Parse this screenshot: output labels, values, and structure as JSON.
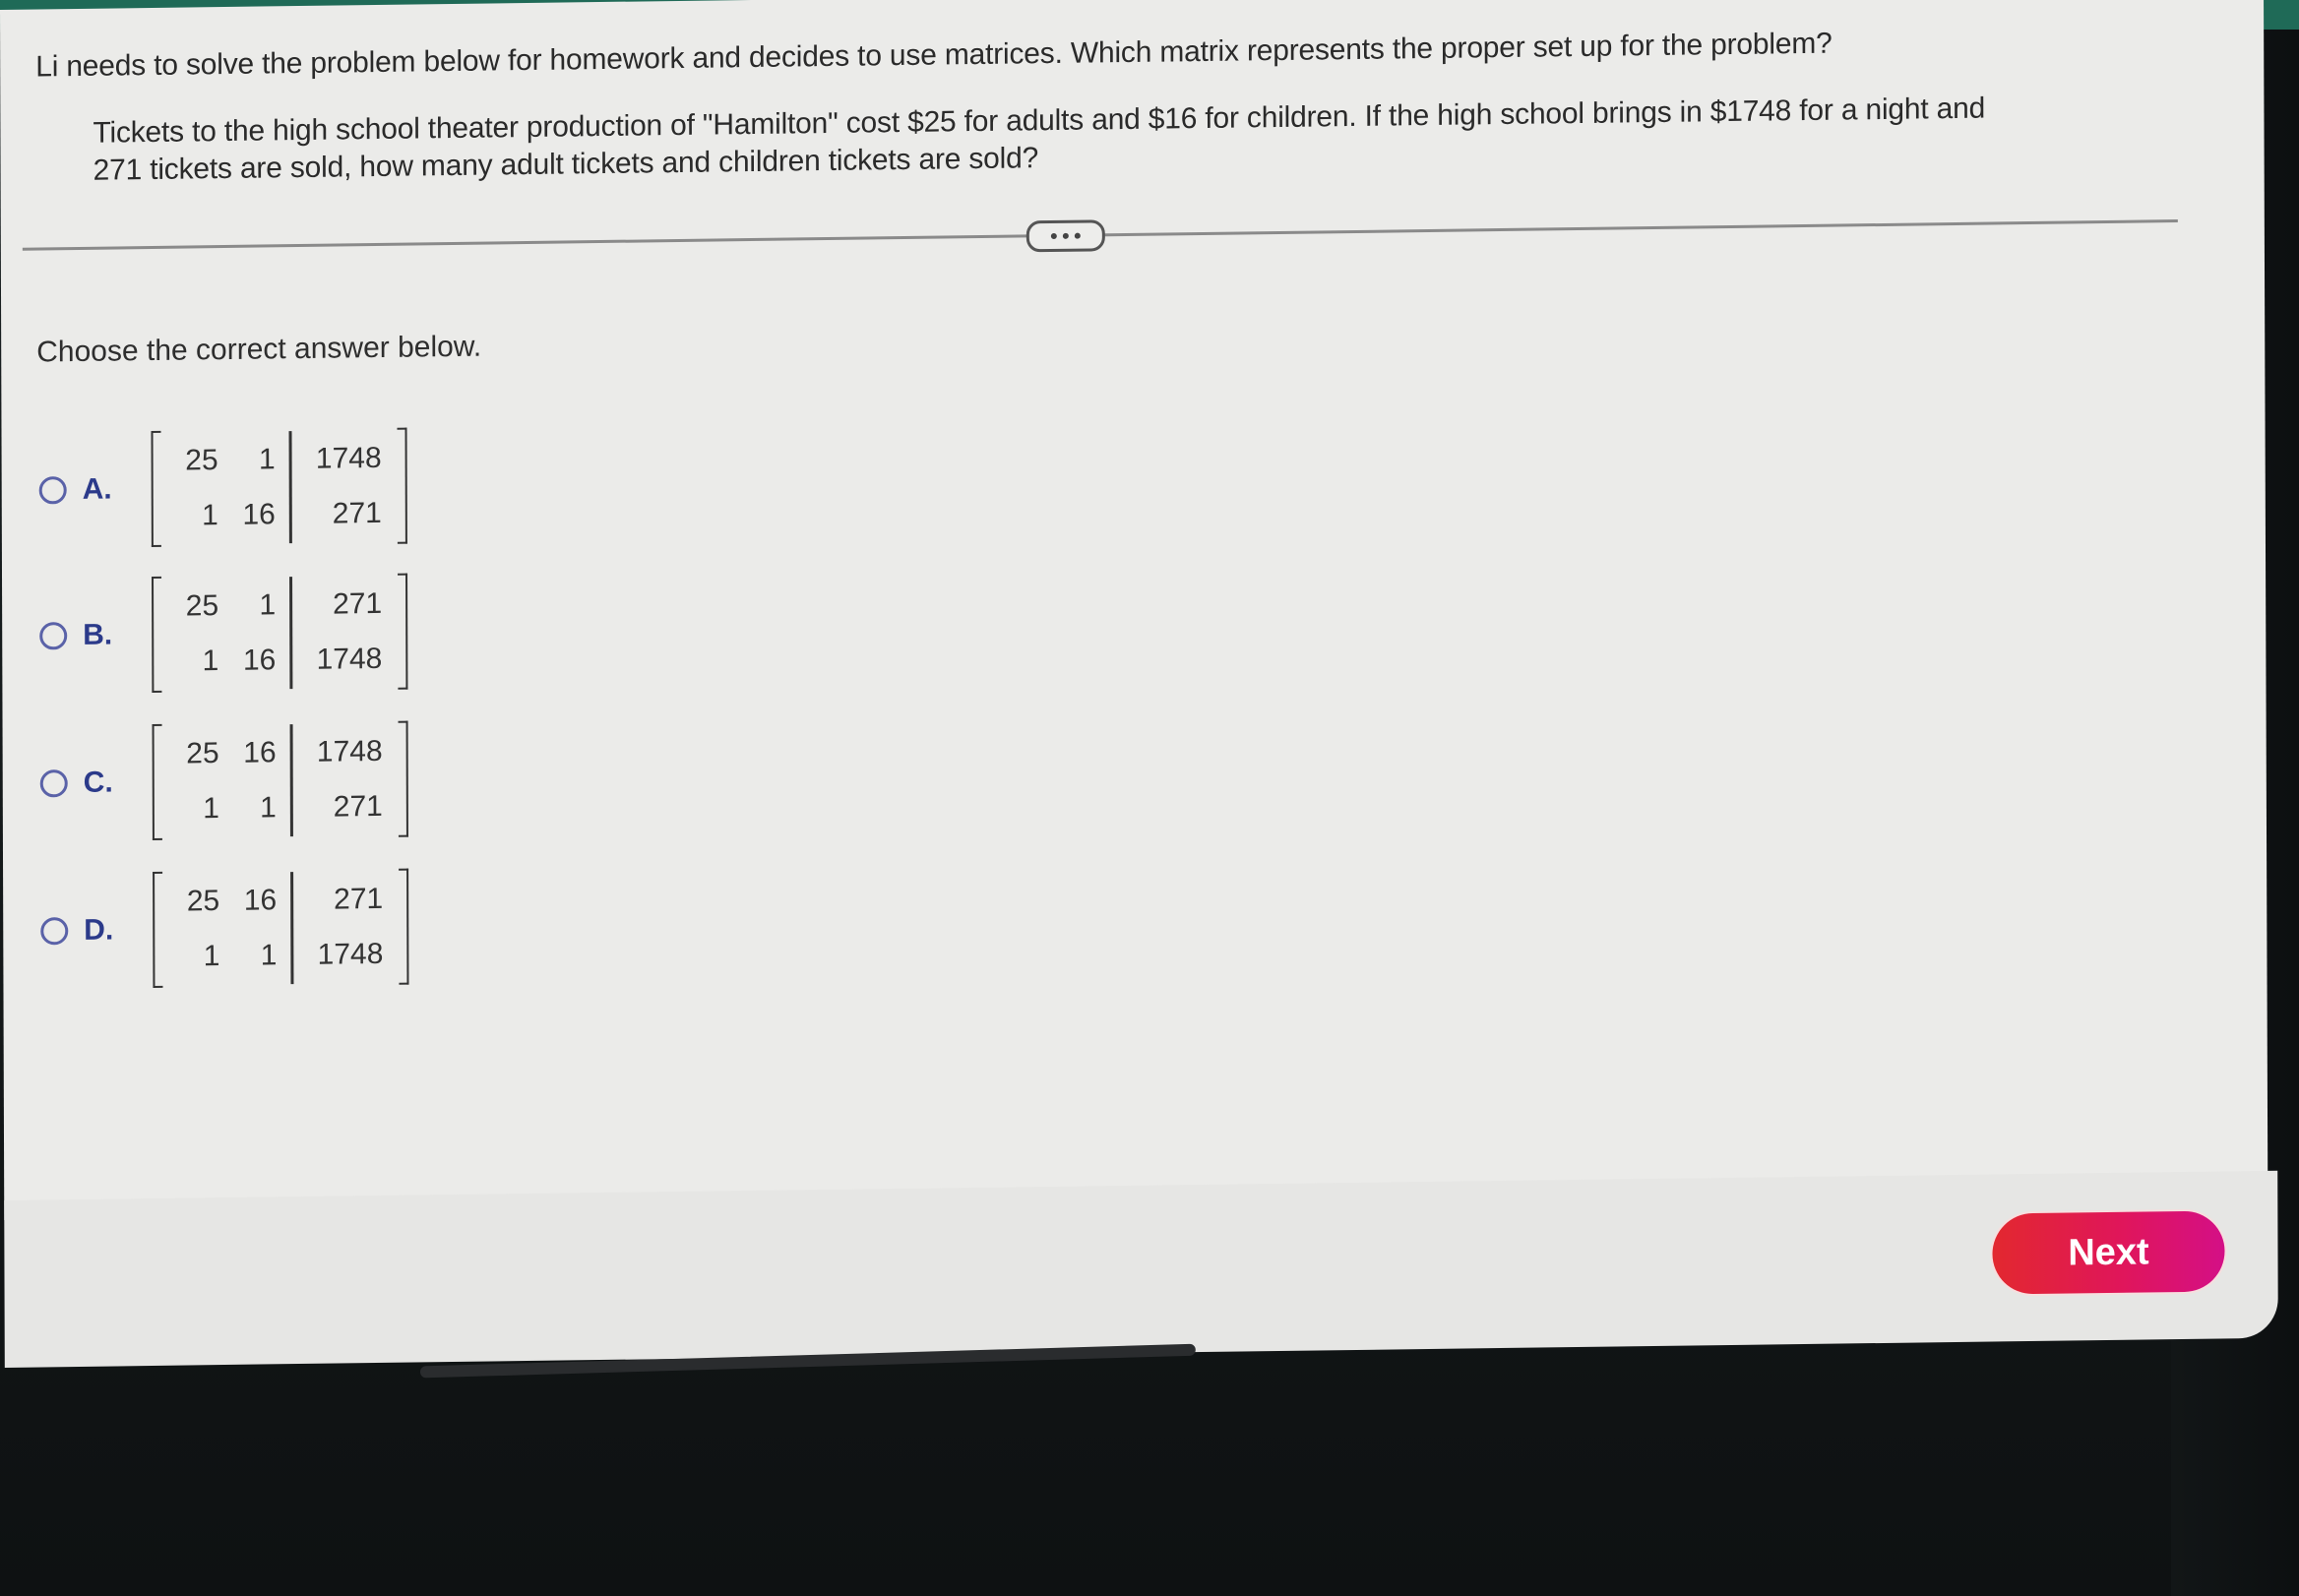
{
  "question": {
    "prompt": "Li needs to solve the problem below for homework and decides to use matrices. Which matrix represents the proper set up for the problem?",
    "problem_line1": "Tickets to the high school theater production of \"Hamilton\" cost $25 for adults and $16 for children. If the high school brings in $1748 for a night and",
    "problem_line2": "271 tickets are sold, how many adult tickets and children tickets are sold?"
  },
  "expand_button": {
    "icon": "more-dots-icon"
  },
  "instruction": "Choose the correct answer below.",
  "options": [
    {
      "letter": "A.",
      "selected": false,
      "matrix": [
        [
          "25",
          "1",
          "1748"
        ],
        [
          "1",
          "16",
          "271"
        ]
      ]
    },
    {
      "letter": "B.",
      "selected": false,
      "matrix": [
        [
          "25",
          "1",
          "271"
        ],
        [
          "1",
          "16",
          "1748"
        ]
      ]
    },
    {
      "letter": "C.",
      "selected": false,
      "matrix": [
        [
          "25",
          "16",
          "1748"
        ],
        [
          "1",
          "1",
          "271"
        ]
      ]
    },
    {
      "letter": "D.",
      "selected": false,
      "matrix": [
        [
          "25",
          "16",
          "271"
        ],
        [
          "1",
          "1",
          "1748"
        ]
      ]
    }
  ],
  "footer": {
    "next_label": "Next"
  },
  "colors": {
    "accent_green": "#1f6a57",
    "radio_blue": "#5a62a8",
    "letter_blue": "#2b3a8a",
    "next_gradient_start": "#e2282f",
    "next_gradient_end": "#d40f86"
  }
}
